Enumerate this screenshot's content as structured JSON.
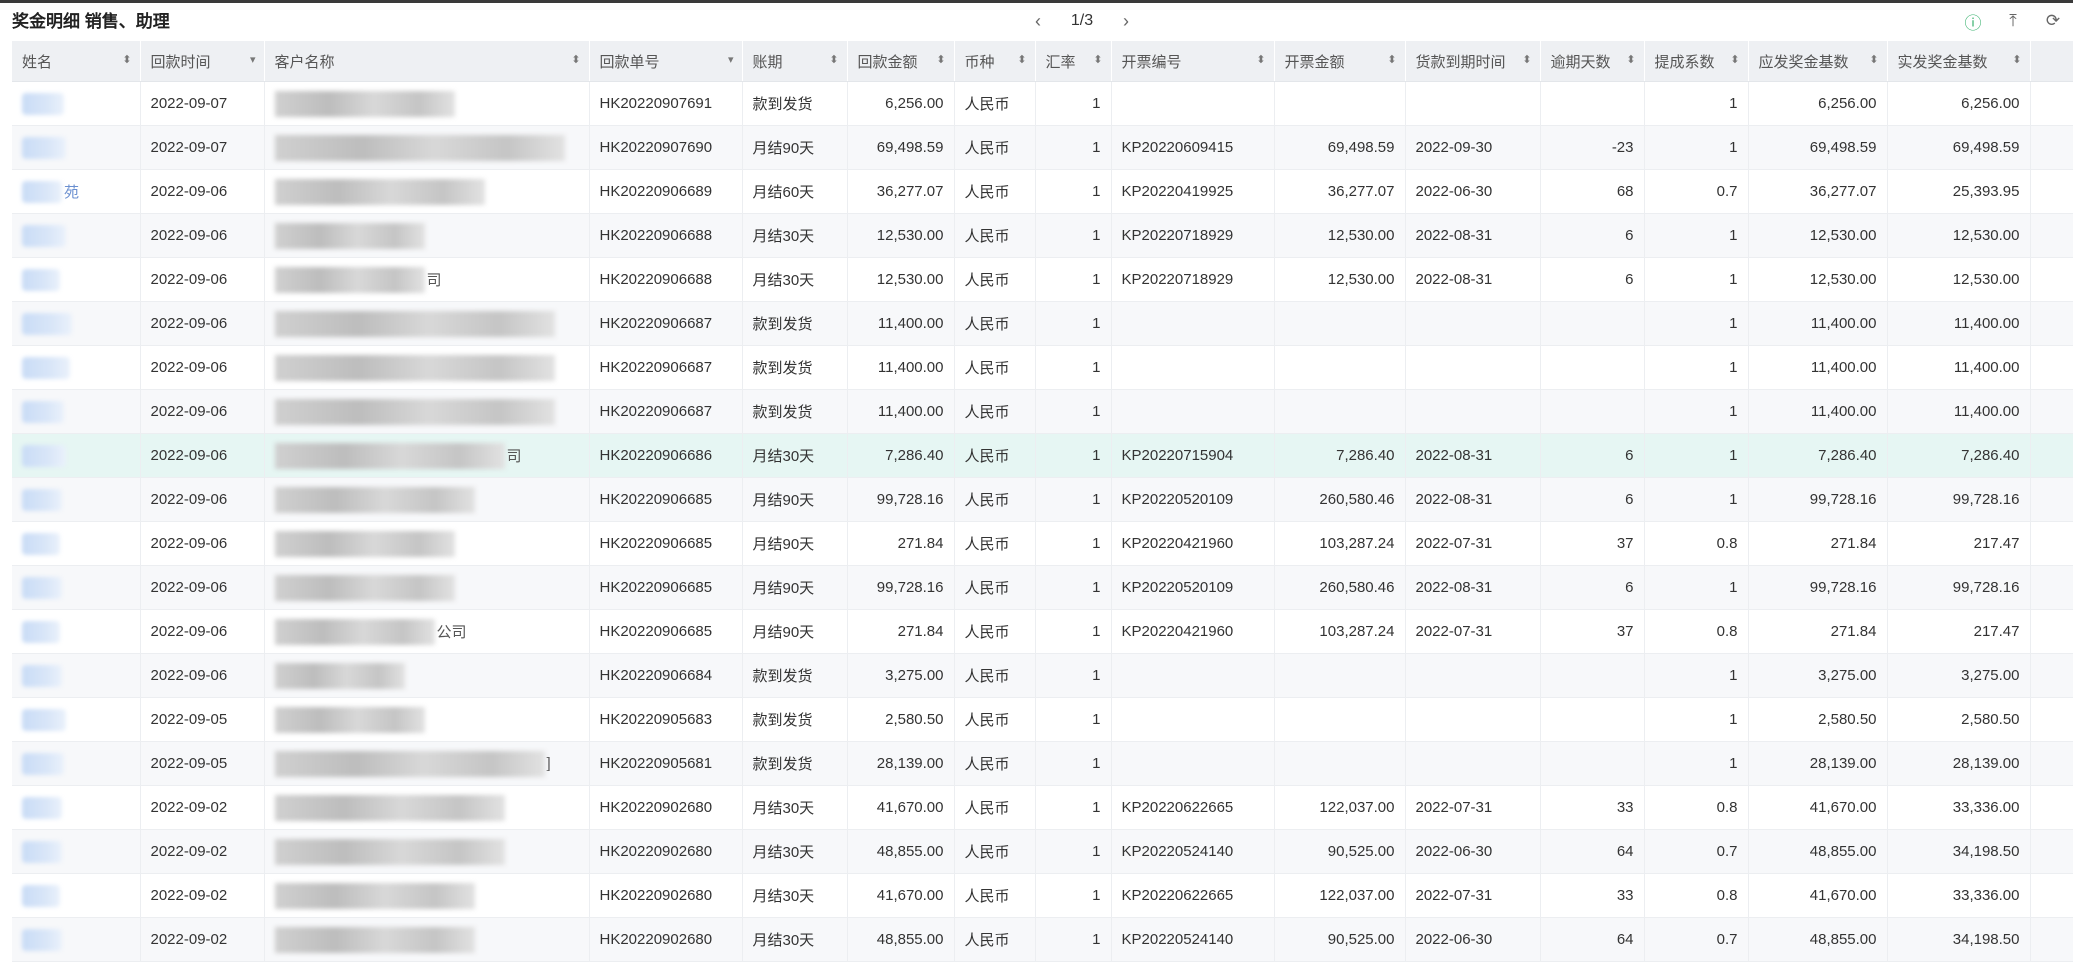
{
  "title": "奖金明细 销售、助理",
  "pager": {
    "prev": "‹",
    "page": "1/3",
    "next": "›"
  },
  "tools": {
    "info": "ⓘ",
    "export": "⤒",
    "refresh": "⟳"
  },
  "columns": [
    {
      "key": "name",
      "label": "姓名",
      "sort": "⬍"
    },
    {
      "key": "date",
      "label": "回款时间",
      "sort": "▾"
    },
    {
      "key": "customer",
      "label": "客户名称",
      "sort": "⬍"
    },
    {
      "key": "receipt",
      "label": "回款单号",
      "sort": "▾"
    },
    {
      "key": "term",
      "label": "账期",
      "sort": "⬍"
    },
    {
      "key": "amount",
      "label": "回款金额",
      "sort": "⬍"
    },
    {
      "key": "currency",
      "label": "币种",
      "sort": "⬍"
    },
    {
      "key": "rate",
      "label": "汇率",
      "sort": "⬍"
    },
    {
      "key": "invoice_no",
      "label": "开票编号",
      "sort": "⬍"
    },
    {
      "key": "invoice_amt",
      "label": "开票金额",
      "sort": "⬍"
    },
    {
      "key": "due",
      "label": "货款到期时间",
      "sort": "⬍"
    },
    {
      "key": "overdue",
      "label": "逾期天数",
      "sort": "⬍"
    },
    {
      "key": "coef",
      "label": "提成系数",
      "sort": "⬍"
    },
    {
      "key": "base",
      "label": "应发奖金基数",
      "sort": "⬍"
    },
    {
      "key": "actual",
      "label": "实发奖金基数",
      "sort": "⬍"
    }
  ],
  "rows": [
    {
      "name_tail": "",
      "customer_tail": "",
      "date": "2022-09-07",
      "receipt": "HK20220907691",
      "term": "款到发货",
      "amount": "6,256.00",
      "currency": "人民币",
      "rate": "1",
      "invoice_no": "",
      "invoice_amt": "",
      "due": "",
      "overdue": "",
      "coef": "1",
      "base": "6,256.00",
      "actual": "6,256.00"
    },
    {
      "name_tail": "",
      "customer_tail": "",
      "date": "2022-09-07",
      "receipt": "HK20220907690",
      "term": "月结90天",
      "amount": "69,498.59",
      "currency": "人民币",
      "rate": "1",
      "invoice_no": "KP20220609415",
      "invoice_amt": "69,498.59",
      "due": "2022-09-30",
      "overdue": "-23",
      "coef": "1",
      "base": "69,498.59",
      "actual": "69,498.59"
    },
    {
      "name_tail": "苑",
      "customer_tail": "",
      "date": "2022-09-06",
      "receipt": "HK20220906689",
      "term": "月结60天",
      "amount": "36,277.07",
      "currency": "人民币",
      "rate": "1",
      "invoice_no": "KP20220419925",
      "invoice_amt": "36,277.07",
      "due": "2022-06-30",
      "overdue": "68",
      "coef": "0.7",
      "base": "36,277.07",
      "actual": "25,393.95"
    },
    {
      "name_tail": "",
      "customer_tail": "",
      "date": "2022-09-06",
      "receipt": "HK20220906688",
      "term": "月结30天",
      "amount": "12,530.00",
      "currency": "人民币",
      "rate": "1",
      "invoice_no": "KP20220718929",
      "invoice_amt": "12,530.00",
      "due": "2022-08-31",
      "overdue": "6",
      "coef": "1",
      "base": "12,530.00",
      "actual": "12,530.00"
    },
    {
      "name_tail": "",
      "customer_tail": "司",
      "date": "2022-09-06",
      "receipt": "HK20220906688",
      "term": "月结30天",
      "amount": "12,530.00",
      "currency": "人民币",
      "rate": "1",
      "invoice_no": "KP20220718929",
      "invoice_amt": "12,530.00",
      "due": "2022-08-31",
      "overdue": "6",
      "coef": "1",
      "base": "12,530.00",
      "actual": "12,530.00"
    },
    {
      "name_tail": "",
      "customer_tail": "",
      "date": "2022-09-06",
      "receipt": "HK20220906687",
      "term": "款到发货",
      "amount": "11,400.00",
      "currency": "人民币",
      "rate": "1",
      "invoice_no": "",
      "invoice_amt": "",
      "due": "",
      "overdue": "",
      "coef": "1",
      "base": "11,400.00",
      "actual": "11,400.00"
    },
    {
      "name_tail": "",
      "customer_tail": "",
      "date": "2022-09-06",
      "receipt": "HK20220906687",
      "term": "款到发货",
      "amount": "11,400.00",
      "currency": "人民币",
      "rate": "1",
      "invoice_no": "",
      "invoice_amt": "",
      "due": "",
      "overdue": "",
      "coef": "1",
      "base": "11,400.00",
      "actual": "11,400.00"
    },
    {
      "name_tail": "",
      "customer_tail": "",
      "date": "2022-09-06",
      "receipt": "HK20220906687",
      "term": "款到发货",
      "amount": "11,400.00",
      "currency": "人民币",
      "rate": "1",
      "invoice_no": "",
      "invoice_amt": "",
      "due": "",
      "overdue": "",
      "coef": "1",
      "base": "11,400.00",
      "actual": "11,400.00"
    },
    {
      "name_tail": "",
      "customer_tail": "司",
      "date": "2022-09-06",
      "receipt": "HK20220906686",
      "term": "月结30天",
      "amount": "7,286.40",
      "currency": "人民币",
      "rate": "1",
      "invoice_no": "KP20220715904",
      "invoice_amt": "7,286.40",
      "due": "2022-08-31",
      "overdue": "6",
      "coef": "1",
      "base": "7,286.40",
      "actual": "7,286.40",
      "highlight": true
    },
    {
      "name_tail": "",
      "customer_tail": "",
      "date": "2022-09-06",
      "receipt": "HK20220906685",
      "term": "月结90天",
      "amount": "99,728.16",
      "currency": "人民币",
      "rate": "1",
      "invoice_no": "KP20220520109",
      "invoice_amt": "260,580.46",
      "due": "2022-08-31",
      "overdue": "6",
      "coef": "1",
      "base": "99,728.16",
      "actual": "99,728.16"
    },
    {
      "name_tail": "",
      "customer_tail": "",
      "date": "2022-09-06",
      "receipt": "HK20220906685",
      "term": "月结90天",
      "amount": "271.84",
      "currency": "人民币",
      "rate": "1",
      "invoice_no": "KP20220421960",
      "invoice_amt": "103,287.24",
      "due": "2022-07-31",
      "overdue": "37",
      "coef": "0.8",
      "base": "271.84",
      "actual": "217.47"
    },
    {
      "name_tail": "",
      "customer_tail": "",
      "date": "2022-09-06",
      "receipt": "HK20220906685",
      "term": "月结90天",
      "amount": "99,728.16",
      "currency": "人民币",
      "rate": "1",
      "invoice_no": "KP20220520109",
      "invoice_amt": "260,580.46",
      "due": "2022-08-31",
      "overdue": "6",
      "coef": "1",
      "base": "99,728.16",
      "actual": "99,728.16"
    },
    {
      "name_tail": "",
      "customer_tail": "公司",
      "date": "2022-09-06",
      "receipt": "HK20220906685",
      "term": "月结90天",
      "amount": "271.84",
      "currency": "人民币",
      "rate": "1",
      "invoice_no": "KP20220421960",
      "invoice_amt": "103,287.24",
      "due": "2022-07-31",
      "overdue": "37",
      "coef": "0.8",
      "base": "271.84",
      "actual": "217.47"
    },
    {
      "name_tail": "",
      "customer_tail": "",
      "date": "2022-09-06",
      "receipt": "HK20220906684",
      "term": "款到发货",
      "amount": "3,275.00",
      "currency": "人民币",
      "rate": "1",
      "invoice_no": "",
      "invoice_amt": "",
      "due": "",
      "overdue": "",
      "coef": "1",
      "base": "3,275.00",
      "actual": "3,275.00"
    },
    {
      "name_tail": "",
      "customer_tail": "",
      "date": "2022-09-05",
      "receipt": "HK20220905683",
      "term": "款到发货",
      "amount": "2,580.50",
      "currency": "人民币",
      "rate": "1",
      "invoice_no": "",
      "invoice_amt": "",
      "due": "",
      "overdue": "",
      "coef": "1",
      "base": "2,580.50",
      "actual": "2,580.50"
    },
    {
      "name_tail": "",
      "customer_tail": "]",
      "date": "2022-09-05",
      "receipt": "HK20220905681",
      "term": "款到发货",
      "amount": "28,139.00",
      "currency": "人民币",
      "rate": "1",
      "invoice_no": "",
      "invoice_amt": "",
      "due": "",
      "overdue": "",
      "coef": "1",
      "base": "28,139.00",
      "actual": "28,139.00"
    },
    {
      "name_tail": "",
      "customer_tail": "",
      "date": "2022-09-02",
      "receipt": "HK20220902680",
      "term": "月结30天",
      "amount": "41,670.00",
      "currency": "人民币",
      "rate": "1",
      "invoice_no": "KP20220622665",
      "invoice_amt": "122,037.00",
      "due": "2022-07-31",
      "overdue": "33",
      "coef": "0.8",
      "base": "41,670.00",
      "actual": "33,336.00"
    },
    {
      "name_tail": "",
      "customer_tail": "",
      "date": "2022-09-02",
      "receipt": "HK20220902680",
      "term": "月结30天",
      "amount": "48,855.00",
      "currency": "人民币",
      "rate": "1",
      "invoice_no": "KP20220524140",
      "invoice_amt": "90,525.00",
      "due": "2022-06-30",
      "overdue": "64",
      "coef": "0.7",
      "base": "48,855.00",
      "actual": "34,198.50"
    },
    {
      "name_tail": "",
      "customer_tail": "",
      "date": "2022-09-02",
      "receipt": "HK20220902680",
      "term": "月结30天",
      "amount": "41,670.00",
      "currency": "人民币",
      "rate": "1",
      "invoice_no": "KP20220622665",
      "invoice_amt": "122,037.00",
      "due": "2022-07-31",
      "overdue": "33",
      "coef": "0.8",
      "base": "41,670.00",
      "actual": "33,336.00"
    },
    {
      "name_tail": "",
      "customer_tail": "",
      "date": "2022-09-02",
      "receipt": "HK20220902680",
      "term": "月结30天",
      "amount": "48,855.00",
      "currency": "人民币",
      "rate": "1",
      "invoice_no": "KP20220524140",
      "invoice_amt": "90,525.00",
      "due": "2022-06-30",
      "overdue": "64",
      "coef": "0.7",
      "base": "48,855.00",
      "actual": "34,198.50"
    }
  ]
}
